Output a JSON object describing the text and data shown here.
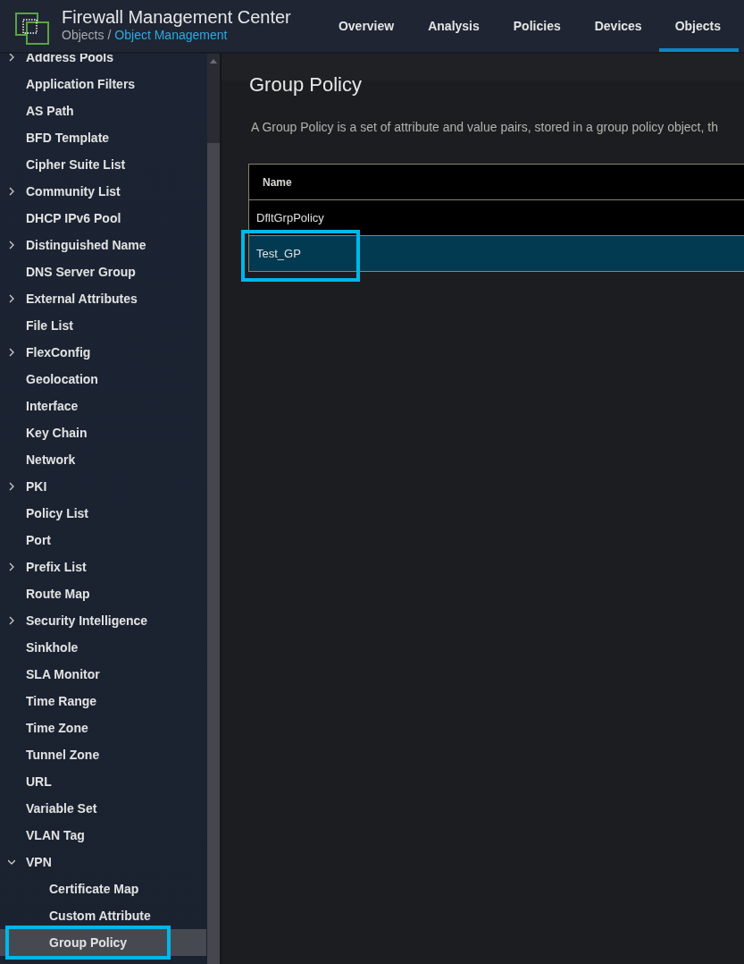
{
  "app": {
    "title": "Firewall Management Center",
    "breadcrumb": [
      {
        "label": "Objects",
        "kind": "text"
      },
      {
        "label": "/",
        "kind": "separator"
      },
      {
        "label": "Object Management",
        "kind": "link"
      }
    ]
  },
  "nav": [
    {
      "label": "Overview",
      "selected": false
    },
    {
      "label": "Analysis",
      "selected": false
    },
    {
      "label": "Policies",
      "selected": false
    },
    {
      "label": "Devices",
      "selected": false
    },
    {
      "label": "Objects",
      "selected": true
    }
  ],
  "sidebar": {
    "items": [
      {
        "label": "Address Pools",
        "kind": "group",
        "expanded": false,
        "selected": false
      },
      {
        "label": "Application Filters",
        "kind": "leaf",
        "selected": false
      },
      {
        "label": "AS Path",
        "kind": "leaf",
        "selected": false
      },
      {
        "label": "BFD Template",
        "kind": "leaf",
        "selected": false
      },
      {
        "label": "Cipher Suite List",
        "kind": "leaf",
        "selected": false
      },
      {
        "label": "Community List",
        "kind": "group",
        "expanded": false,
        "selected": false
      },
      {
        "label": "DHCP IPv6 Pool",
        "kind": "leaf",
        "selected": false
      },
      {
        "label": "Distinguished Name",
        "kind": "group",
        "expanded": false,
        "selected": false
      },
      {
        "label": "DNS Server Group",
        "kind": "leaf",
        "selected": false
      },
      {
        "label": "External Attributes",
        "kind": "group",
        "expanded": false,
        "selected": false
      },
      {
        "label": "File List",
        "kind": "leaf",
        "selected": false
      },
      {
        "label": "FlexConfig",
        "kind": "group",
        "expanded": false,
        "selected": false
      },
      {
        "label": "Geolocation",
        "kind": "leaf",
        "selected": false
      },
      {
        "label": "Interface",
        "kind": "leaf",
        "selected": false
      },
      {
        "label": "Key Chain",
        "kind": "leaf",
        "selected": false
      },
      {
        "label": "Network",
        "kind": "leaf",
        "selected": false
      },
      {
        "label": "PKI",
        "kind": "group",
        "expanded": false,
        "selected": false
      },
      {
        "label": "Policy List",
        "kind": "leaf",
        "selected": false
      },
      {
        "label": "Port",
        "kind": "leaf",
        "selected": false
      },
      {
        "label": "Prefix List",
        "kind": "group",
        "expanded": false,
        "selected": false
      },
      {
        "label": "Route Map",
        "kind": "leaf",
        "selected": false
      },
      {
        "label": "Security Intelligence",
        "kind": "group",
        "expanded": false,
        "selected": false
      },
      {
        "label": "Sinkhole",
        "kind": "leaf",
        "selected": false
      },
      {
        "label": "SLA Monitor",
        "kind": "leaf",
        "selected": false
      },
      {
        "label": "Time Range",
        "kind": "leaf",
        "selected": false
      },
      {
        "label": "Time Zone",
        "kind": "leaf",
        "selected": false
      },
      {
        "label": "Tunnel Zone",
        "kind": "leaf",
        "selected": false
      },
      {
        "label": "URL",
        "kind": "leaf",
        "selected": false
      },
      {
        "label": "Variable Set",
        "kind": "leaf",
        "selected": false
      },
      {
        "label": "VLAN Tag",
        "kind": "leaf",
        "selected": false
      },
      {
        "label": "VPN",
        "kind": "group",
        "expanded": true,
        "selected": false,
        "children": [
          {
            "label": "Certificate Map",
            "kind": "leaf",
            "selected": false
          },
          {
            "label": "Custom Attribute",
            "kind": "leaf",
            "selected": false
          },
          {
            "label": "Group Policy",
            "kind": "leaf",
            "selected": true,
            "highlighted": true
          }
        ]
      }
    ]
  },
  "content": {
    "title": "Group Policy",
    "description": "A Group Policy is a set of attribute and value pairs, stored in a group policy object, th",
    "table": {
      "columns": [
        "Name"
      ],
      "rows": [
        {
          "cells": [
            "DfltGrpPolicy"
          ],
          "selected": false,
          "highlighted": false
        },
        {
          "cells": [
            "Test_GP"
          ],
          "selected": true,
          "highlighted": true
        }
      ]
    }
  }
}
